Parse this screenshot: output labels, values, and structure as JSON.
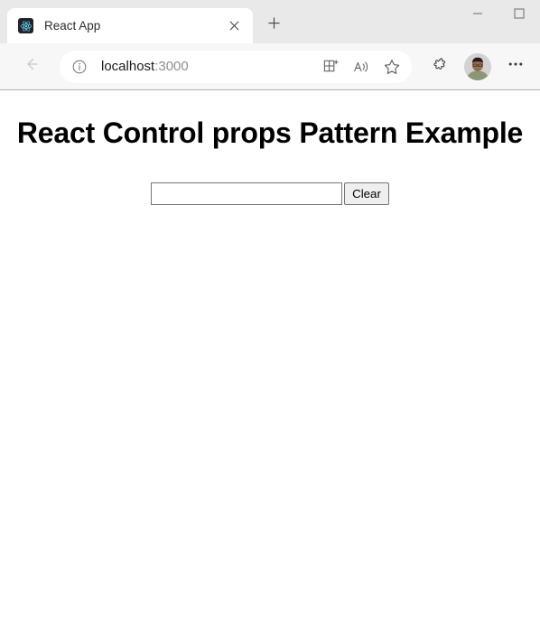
{
  "browser": {
    "tab": {
      "title": "React App",
      "favicon_icon": "react-logo-icon",
      "close_icon": "close-icon"
    },
    "new_tab_icon": "plus-icon",
    "window_controls": [
      {
        "name": "minimize-button",
        "icon": "minimize-icon"
      },
      {
        "name": "maximize-button",
        "icon": "maximize-icon"
      }
    ],
    "toolbar": {
      "back_icon": "back-arrow-icon",
      "site_info_icon": "info-circle-icon",
      "url_host": "localhost",
      "url_port": ":3000",
      "url_full": "localhost:3000",
      "split_screen_icon": "split-screen-add-icon",
      "read_aloud_icon": "read-aloud-icon",
      "favorites_icon": "star-icon",
      "extensions_icon": "extensions-puzzle-icon",
      "avatar_icon": "profile-avatar",
      "more_icon": "ellipsis-icon"
    }
  },
  "page": {
    "heading": "React Control props Pattern Example",
    "form": {
      "input_value": "",
      "input_placeholder": "",
      "clear_label": "Clear"
    }
  },
  "colors": {
    "titlebar_bg": "#e9e9e9",
    "toolbar_bg": "#f7f7f7",
    "tab_bg": "#ffffff",
    "page_bg": "#ffffff",
    "react_logo": "#61dafb",
    "react_logo_bg": "#20232a",
    "text": "#000000",
    "url_port": "#8f8f8f",
    "button_bg": "#efefef",
    "border": "#767676"
  }
}
